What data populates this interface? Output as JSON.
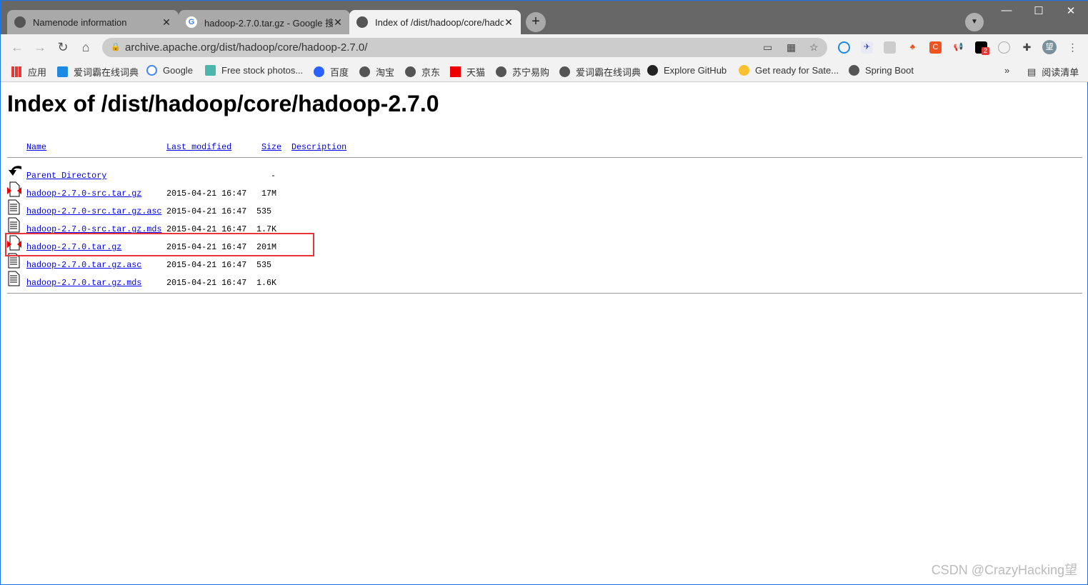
{
  "browser": {
    "tabs": [
      {
        "title": "Namenode information",
        "icon": "globe-icon"
      },
      {
        "title": "hadoop-2.7.0.tar.gz - Google 搜",
        "icon": "google-icon"
      },
      {
        "title": "Index of /dist/hadoop/core/hadoop",
        "icon": "globe-icon",
        "active": true
      }
    ],
    "address": "archive.apache.org/dist/hadoop/core/hadoop-2.7.0/",
    "profile_label": "望",
    "extension_badge": "2",
    "bookmarks": [
      "应用",
      "爱词霸在线词典",
      "Google",
      "Free stock photos...",
      "百度",
      "淘宝",
      "京东",
      "天猫",
      "苏宁易购",
      "爱词霸在线词典",
      "Explore GitHub",
      "Get ready for Sate...",
      "Spring Boot"
    ],
    "overflow": "»",
    "reading_list": "阅读清单"
  },
  "page": {
    "title": "Index of /dist/hadoop/core/hadoop-2.7.0",
    "headers": {
      "name": "Name",
      "modified": "Last modified",
      "size": "Size",
      "description": "Description"
    },
    "parent": {
      "name": "Parent Directory",
      "size": "-"
    },
    "files": [
      {
        "name": "hadoop-2.7.0-src.tar.gz",
        "modified": "2015-04-21 16:47",
        "size": "17M",
        "type": "archive"
      },
      {
        "name": "hadoop-2.7.0-src.tar.gz.asc",
        "modified": "2015-04-21 16:47",
        "size": "535",
        "type": "text"
      },
      {
        "name": "hadoop-2.7.0-src.tar.gz.mds",
        "modified": "2015-04-21 16:47",
        "size": "1.7K",
        "type": "text"
      },
      {
        "name": "hadoop-2.7.0.tar.gz",
        "modified": "2015-04-21 16:47",
        "size": "201M",
        "type": "archive",
        "highlighted": true
      },
      {
        "name": "hadoop-2.7.0.tar.gz.asc",
        "modified": "2015-04-21 16:47",
        "size": "535",
        "type": "text"
      },
      {
        "name": "hadoop-2.7.0.tar.gz.mds",
        "modified": "2015-04-21 16:47",
        "size": "1.6K",
        "type": "text"
      }
    ],
    "highlight_color": "#e8353b"
  },
  "watermark": "CSDN @CrazyHacking望"
}
